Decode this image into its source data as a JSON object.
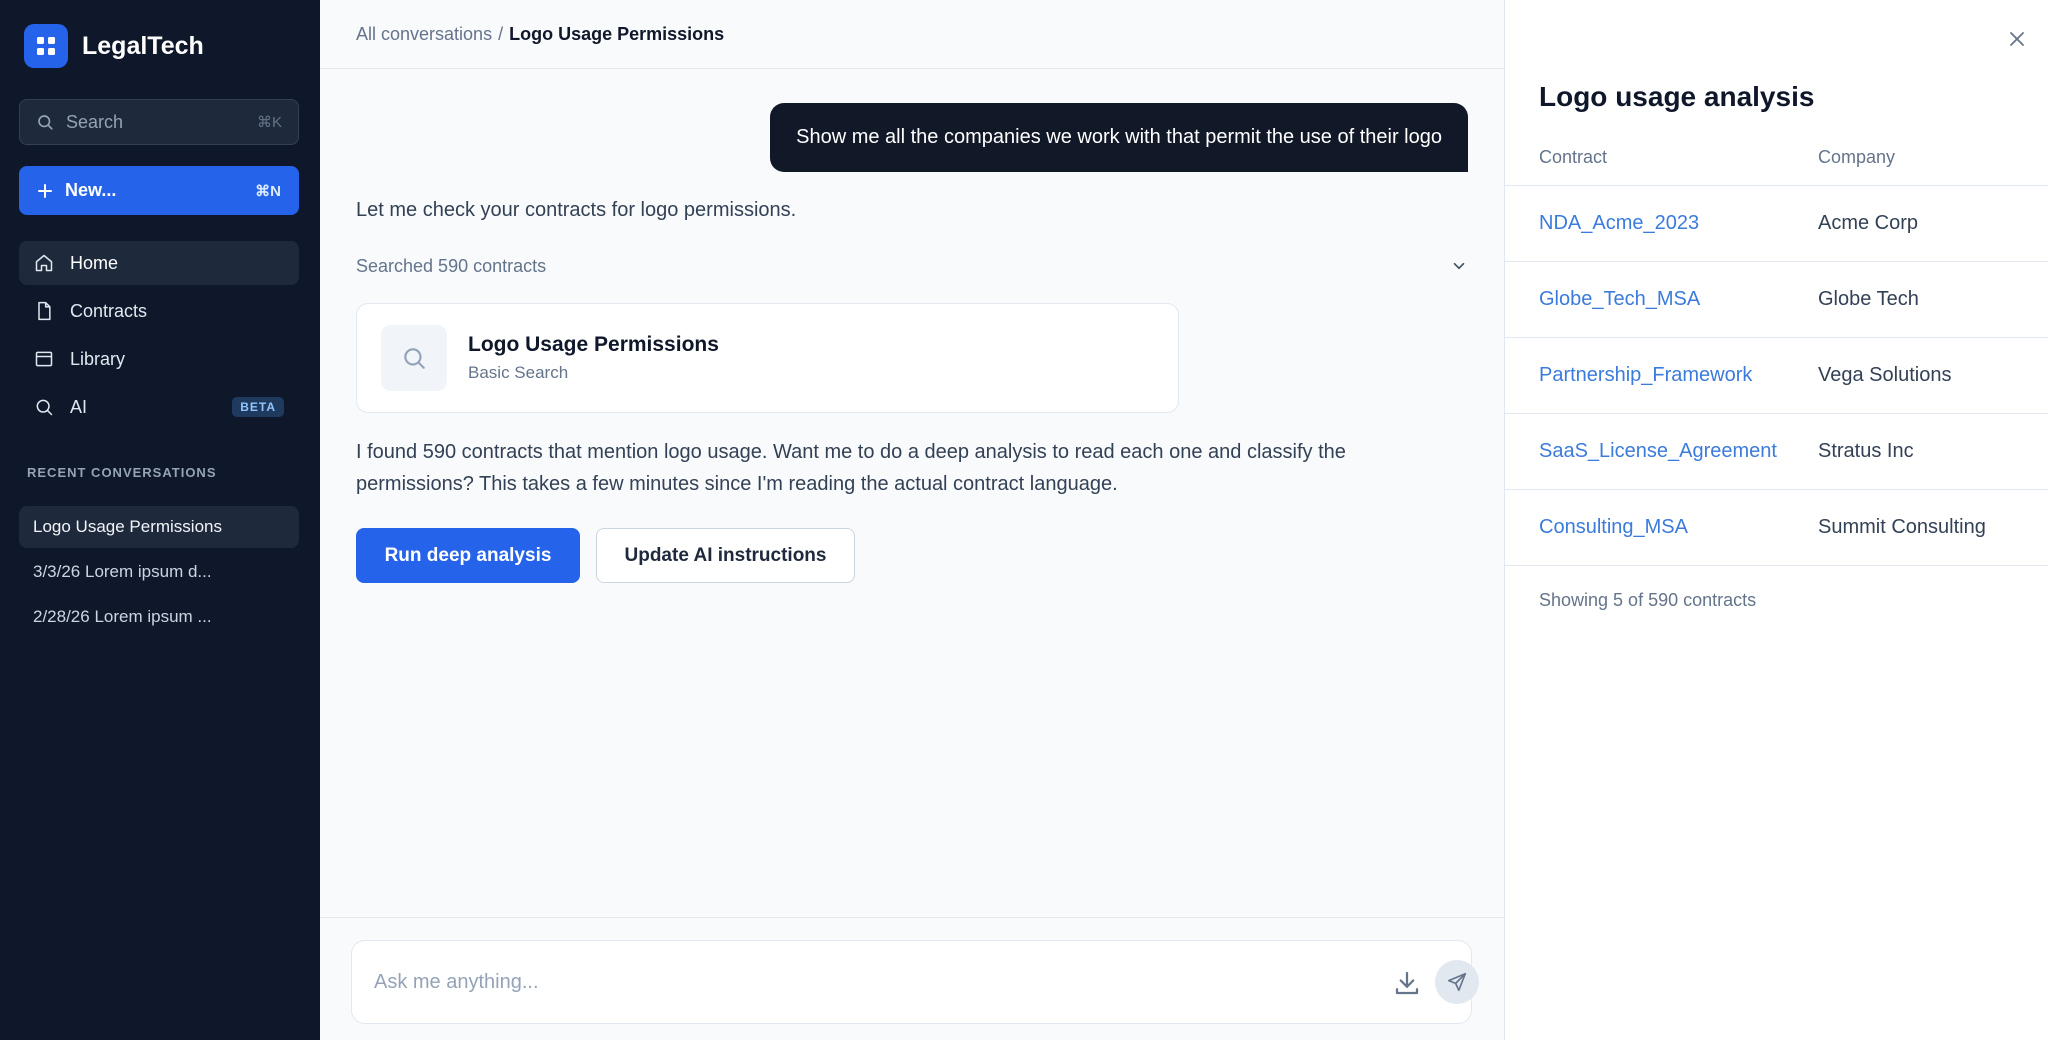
{
  "app": {
    "name": "LegalTech",
    "colors": {
      "sidebar": "#0f172a",
      "accent": "#2563eb",
      "link": "#3b7bdb"
    }
  },
  "sidebar": {
    "search": {
      "label": "Search",
      "shortcut": "⌘K",
      "icon": "search-icon"
    },
    "new_button": {
      "label": "New...",
      "shortcut": "⌘N",
      "icon": "plus-icon"
    },
    "nav": [
      {
        "label": "Home",
        "icon": "home-icon",
        "active": true
      },
      {
        "label": "Contracts",
        "icon": "file-icon",
        "active": false
      },
      {
        "label": "Library",
        "icon": "library-icon",
        "active": false
      },
      {
        "label": "AI",
        "icon": "search-icon",
        "badge": "BETA",
        "active": false
      }
    ],
    "recent_header": "RECENT CONVERSATIONS",
    "recent": [
      {
        "label": "Logo Usage Permissions",
        "active": true
      },
      {
        "label": "3/3/26 Lorem ipsum d...",
        "active": false
      },
      {
        "label": "2/28/26 Lorem ipsum ...",
        "active": false
      }
    ]
  },
  "main": {
    "breadcrumb": {
      "parent": "All conversations",
      "separator": "/",
      "current": "Logo Usage Permissions"
    },
    "user_message": "Show me all the companies we work with that permit the use of their logo",
    "ai_message_1": "Let me check your contracts for logo permissions.",
    "searched": {
      "label": "Searched 590 contracts",
      "icon": "chevron-down-icon"
    },
    "tool_card": {
      "title": "Logo Usage Permissions",
      "subtitle": "Basic Search",
      "icon": "search-icon"
    },
    "ai_message_2": "I found 590 contracts that mention logo usage. Want me to do a deep analysis to read each one and classify the permissions? This takes a few minutes since I'm reading the actual contract language.",
    "primary_action": "Run deep analysis",
    "secondary_action": "Update AI instructions",
    "composer": {
      "placeholder": "Ask me anything...",
      "download_icon": "download-icon",
      "send_icon": "send-icon"
    }
  },
  "panel": {
    "title": "Logo usage analysis",
    "close_icon": "close-icon",
    "columns": {
      "contract": "Contract",
      "company": "Company"
    },
    "rows": [
      {
        "contract": "NDA_Acme_2023",
        "company": "Acme Corp"
      },
      {
        "contract": "Globe_Tech_MSA",
        "company": "Globe Tech"
      },
      {
        "contract": "Partnership_Framework",
        "company": "Vega Solutions"
      },
      {
        "contract": "SaaS_License_Agreement",
        "company": "Stratus Inc"
      },
      {
        "contract": "Consulting_MSA",
        "company": "Summit Consulting"
      }
    ],
    "footer": "Showing 5 of 590 contracts"
  }
}
